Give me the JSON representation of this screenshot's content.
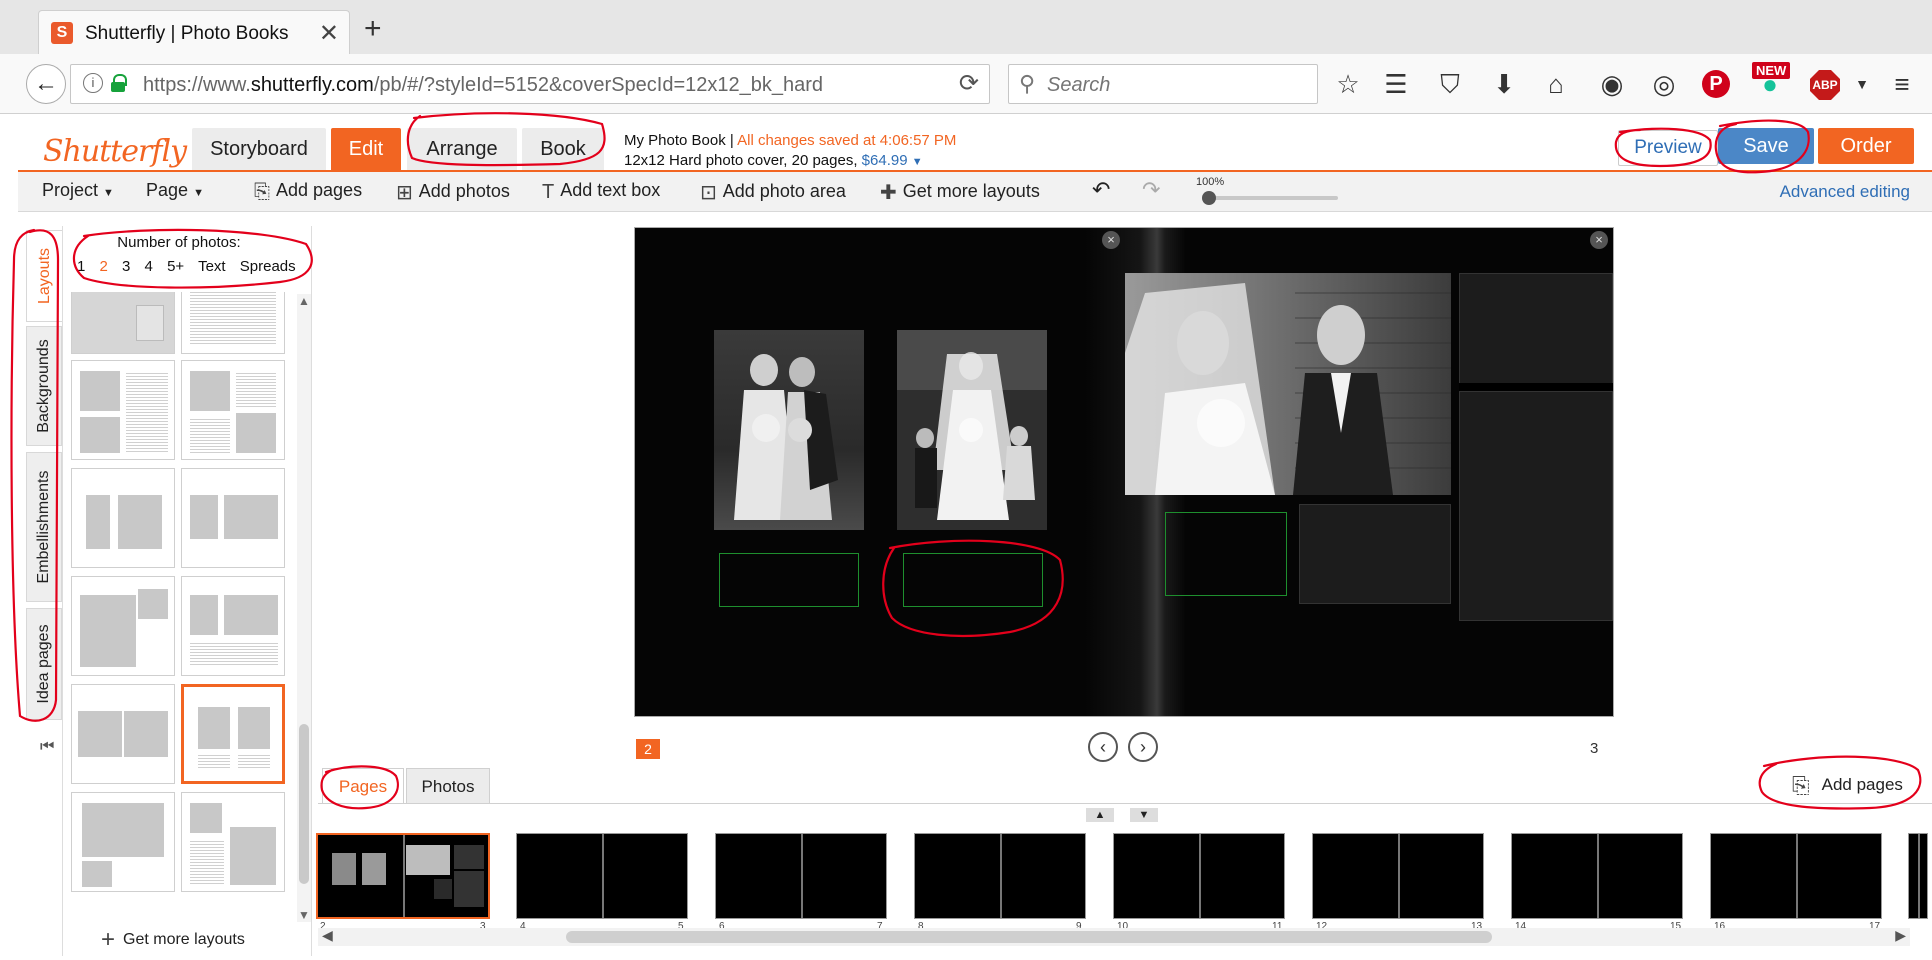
{
  "browser": {
    "tab_title": "Shutterfly | Photo Books",
    "favicon_letter": "S",
    "url_base": "https://www.",
    "url_host": "shutterfly.com",
    "url_path": "/pb/#/?styleId=5152&coverSpecId=12x12_bk_hard",
    "search_placeholder": "Search",
    "new_badge": "NEW",
    "abp_label": "ABP",
    "toolbar_icons": [
      "star-icon",
      "reading-list-icon",
      "pocket-icon",
      "download-icon",
      "home-icon",
      "extension-owl-icon",
      "extension-ghost-icon",
      "pinterest-icon",
      "grammarly-icon",
      "adblock-icon",
      "menu-icon"
    ]
  },
  "app": {
    "logo": "Shutterfly",
    "mode_tabs": [
      "Storyboard",
      "Edit",
      "Arrange",
      "Book"
    ],
    "active_mode": "Edit",
    "book_title": "My Photo Book",
    "save_status": "All changes saved at 4:06:57 PM",
    "book_spec": "12x12 Hard photo cover, 20 pages,",
    "book_price": "$64.99",
    "preview_label": "Preview",
    "save_label": "Save",
    "order_label": "Order"
  },
  "toolbar": {
    "project_label": "Project",
    "page_label": "Page",
    "add_pages": "Add pages",
    "add_photos": "Add photos",
    "add_text_box": "Add text box",
    "add_photo_area": "Add photo area",
    "get_more_layouts": "Get more layouts",
    "zoom": "100%",
    "zoom_level": 0.0,
    "advanced_editing": "Advanced editing"
  },
  "side_tabs": [
    "Layouts",
    "Backgrounds",
    "Embellishments",
    "Idea pages"
  ],
  "active_side_tab": "Layouts",
  "layouts_panel": {
    "number_label": "Number of photos:",
    "options": [
      "1",
      "2",
      "3",
      "4",
      "5+",
      "Text",
      "Spreads"
    ],
    "selected_option": "2",
    "get_more_label": "Get more layouts"
  },
  "canvas": {
    "left_page_number": "2",
    "right_page_number": "3",
    "close_symbol": "×"
  },
  "bottom": {
    "tabs": [
      "Pages",
      "Photos"
    ],
    "active_tab": "Pages",
    "add_pages_label": "Add pages",
    "strip_pages": [
      [
        "2",
        "3"
      ],
      [
        "4",
        "5"
      ],
      [
        "6",
        "7"
      ],
      [
        "8",
        "9"
      ],
      [
        "10",
        "11"
      ],
      [
        "12",
        "13"
      ],
      [
        "14",
        "15"
      ],
      [
        "16",
        "17"
      ]
    ]
  },
  "colors": {
    "brand_orange": "#f26522",
    "save_blue": "#4b87c7",
    "link_blue": "#2f6eb5",
    "annotation_red": "#e3001b"
  }
}
